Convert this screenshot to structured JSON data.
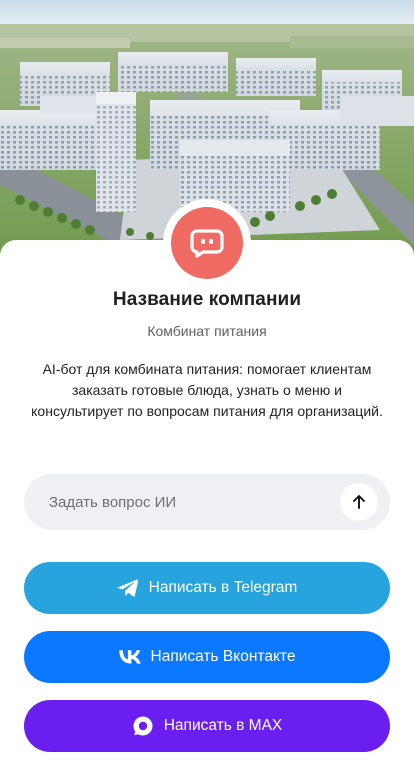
{
  "hero": {
    "image_icon": "factory-campus-aerial-image"
  },
  "profile": {
    "avatar_icon": "chat-bot-icon",
    "avatar_color": "#f06b63",
    "company_name": "Название компании",
    "company_type": "Комбинат питания",
    "description": "AI-бот для комбината питания: помогает клиентам заказать готовые блюда, узнать о меню и консультирует по вопросам питания для организаций."
  },
  "ask": {
    "placeholder": "Задать вопрос ИИ",
    "value": "",
    "send_icon": "arrow-up-icon"
  },
  "buttons": {
    "telegram": {
      "label": "Написать в Telegram",
      "icon": "telegram-icon",
      "color": "#27a3de"
    },
    "vk": {
      "label": "Написать Вконтакте",
      "icon": "vk-icon",
      "color": "#0a79ff"
    },
    "max": {
      "label": "Написать в MAX",
      "icon": "max-icon",
      "color": "#6a1ff0"
    }
  }
}
